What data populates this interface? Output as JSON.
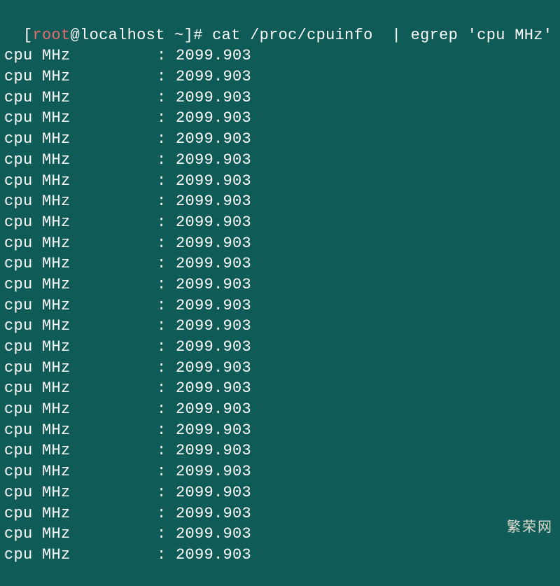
{
  "prompt": {
    "open": "[",
    "user": "root",
    "at": "@",
    "host": "localhost",
    "cwd": " ~",
    "close": "]#",
    "command": " cat /proc/cpuinfo  | egrep ",
    "pattern": "'cpu MHz'"
  },
  "output": {
    "field": "cpu MHz",
    "colon": ": ",
    "rows": [
      "2099.903",
      "2099.903",
      "2099.903",
      "2099.903",
      "2099.903",
      "2099.903",
      "2099.903",
      "2099.903",
      "2099.903",
      "2099.903",
      "2099.903",
      "2099.903",
      "2099.903",
      "2099.903",
      "2099.903",
      "2099.903",
      "2099.903",
      "2099.903",
      "2099.903",
      "2099.903",
      "2099.903",
      "2099.903",
      "2099.903",
      "2099.903",
      "2099.903"
    ]
  },
  "watermark": "繁荣网"
}
